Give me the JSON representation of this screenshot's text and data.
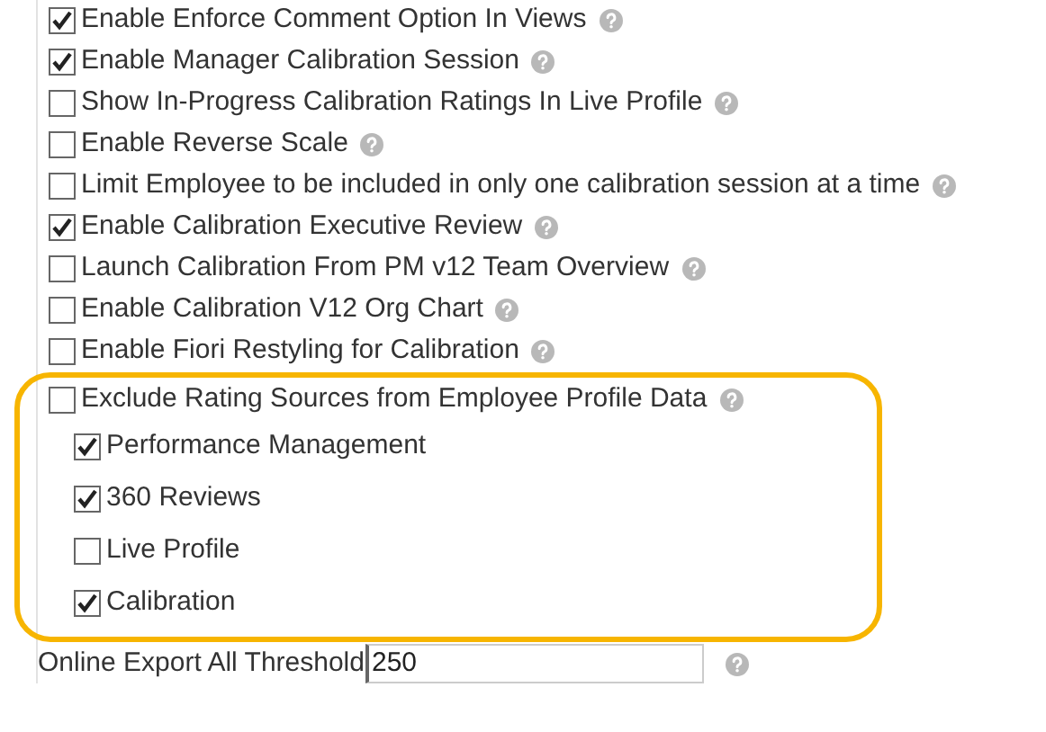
{
  "options": [
    {
      "label": "Enable Enforce Comment Option In Views",
      "checked": true
    },
    {
      "label": "Enable Manager Calibration Session",
      "checked": true
    },
    {
      "label": "Show In-Progress Calibration Ratings In Live Profile",
      "checked": false
    },
    {
      "label": "Enable Reverse Scale",
      "checked": false
    },
    {
      "label": "Limit Employee to be included in only one calibration session at a time",
      "checked": false
    },
    {
      "label": "Enable Calibration Executive Review",
      "checked": true
    },
    {
      "label": "Launch Calibration From PM v12 Team Overview",
      "checked": false
    },
    {
      "label": "Enable Calibration V12 Org Chart",
      "checked": false
    },
    {
      "label": "Enable Fiori Restyling for Calibration",
      "checked": false
    }
  ],
  "exclude": {
    "label": "Exclude Rating Sources from Employee Profile Data",
    "checked": false,
    "sources": [
      {
        "label": "Performance Management",
        "checked": true
      },
      {
        "label": "360 Reviews",
        "checked": true
      },
      {
        "label": "Live Profile",
        "checked": false
      },
      {
        "label": "Calibration",
        "checked": true
      }
    ]
  },
  "threshold": {
    "label": "Online Export All Threshold",
    "value": "250"
  }
}
